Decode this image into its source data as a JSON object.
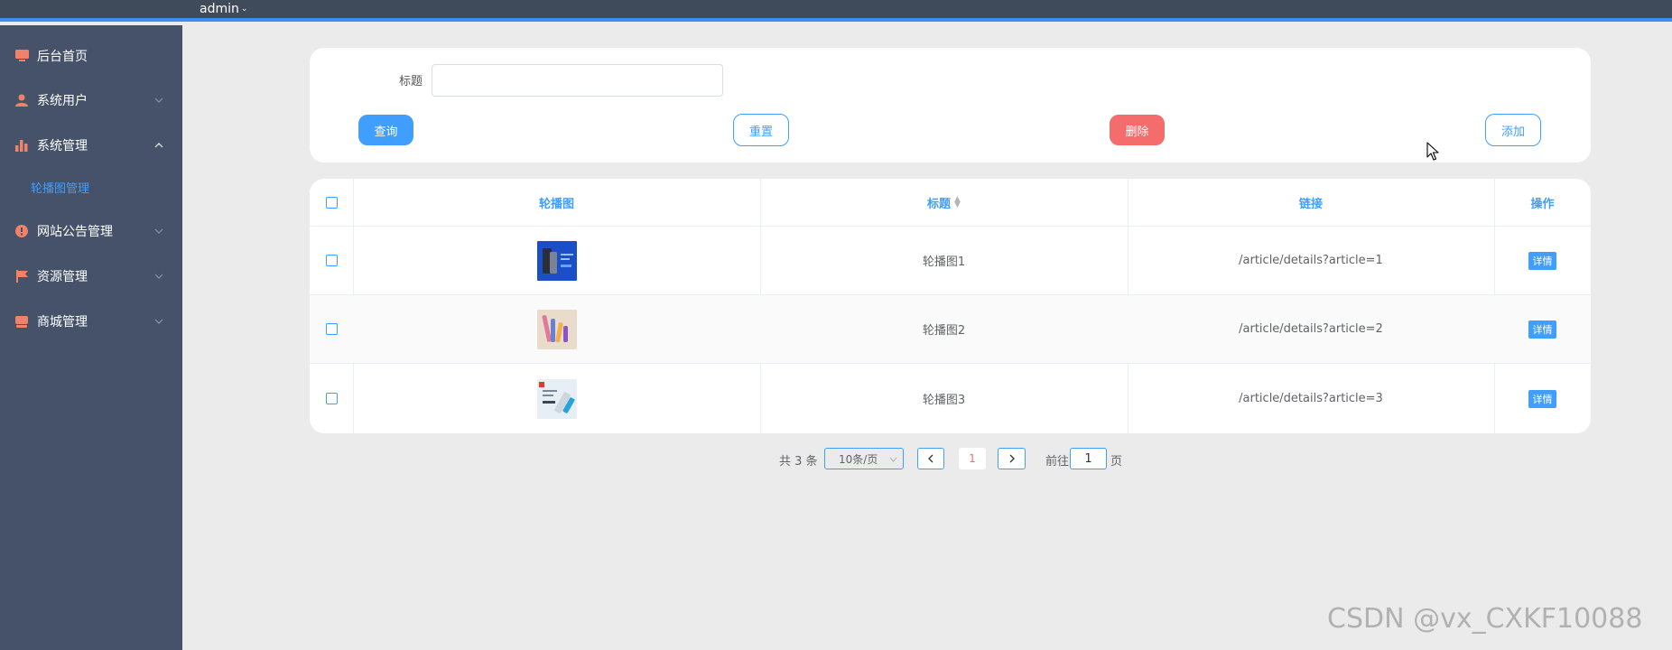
{
  "header": {
    "user_name": "admin"
  },
  "sidebar": {
    "items": [
      {
        "label": "后台首页",
        "icon": "monitor-icon"
      },
      {
        "label": "系统用户",
        "icon": "user-icon"
      },
      {
        "label": "系统管理",
        "icon": "bar-chart-icon",
        "expanded": true,
        "children": [
          {
            "label": "轮播图管理",
            "active": true
          }
        ]
      },
      {
        "label": "网站公告管理",
        "icon": "info-icon"
      },
      {
        "label": "资源管理",
        "icon": "flag-icon"
      },
      {
        "label": "商城管理",
        "icon": "shop-icon"
      }
    ]
  },
  "search": {
    "title_label": "标题",
    "title_value": "",
    "query_label": "查询",
    "reset_label": "重置",
    "delete_label": "删除",
    "add_label": "添加"
  },
  "table": {
    "columns": [
      "轮播图",
      "标题",
      "链接",
      "操作"
    ],
    "rows": [
      {
        "title": "轮播图1",
        "link": "/article/details?article=1",
        "action": "详情"
      },
      {
        "title": "轮播图2",
        "link": "/article/details?article=2",
        "action": "详情"
      },
      {
        "title": "轮播图3",
        "link": "/article/details?article=3",
        "action": "详情"
      }
    ]
  },
  "pagination": {
    "total_text": "共 3 条",
    "page_size": "10条/页",
    "current_page": "1",
    "goto_label": "前往",
    "goto_value": "1",
    "page_suffix": "页"
  },
  "watermark": "CSDN @vx_CXKF10088",
  "colors": {
    "topbar": "#3f4a5a",
    "sidebar": "#45526a",
    "accent": "#409eff",
    "danger": "#f56c6c",
    "icon": "#f08269"
  }
}
